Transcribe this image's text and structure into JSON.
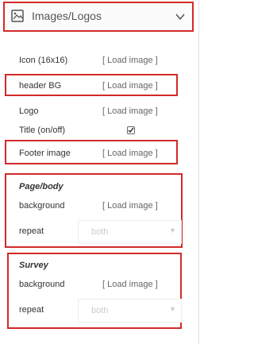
{
  "header": {
    "title": "Images/Logos",
    "icon": "image-icon",
    "toggle_icon": "chevron-down-icon"
  },
  "rows": {
    "icon": {
      "label": "Icon (16x16)",
      "action": "[ Load image ]"
    },
    "header": {
      "label": "header BG",
      "action": "[ Load image ]"
    },
    "logo": {
      "label": "Logo",
      "action": "[ Load image ]"
    },
    "title": {
      "label": "Title (on/off)",
      "checked": true
    },
    "footer": {
      "label": "Footer image",
      "action": "[ Load image ]"
    }
  },
  "page_body": {
    "title": "Page/body",
    "background": {
      "label": "background",
      "action": "[ Load image ]"
    },
    "repeat": {
      "label": "repeat",
      "value": "both"
    }
  },
  "survey": {
    "title": "Survey",
    "background": {
      "label": "background",
      "action": "[ Load image ]"
    },
    "repeat": {
      "label": "repeat",
      "value": "both"
    }
  },
  "colors": {
    "highlight": "#d22a2a",
    "text": "#333333",
    "link": "#666666",
    "disabled": "#cccccc"
  }
}
